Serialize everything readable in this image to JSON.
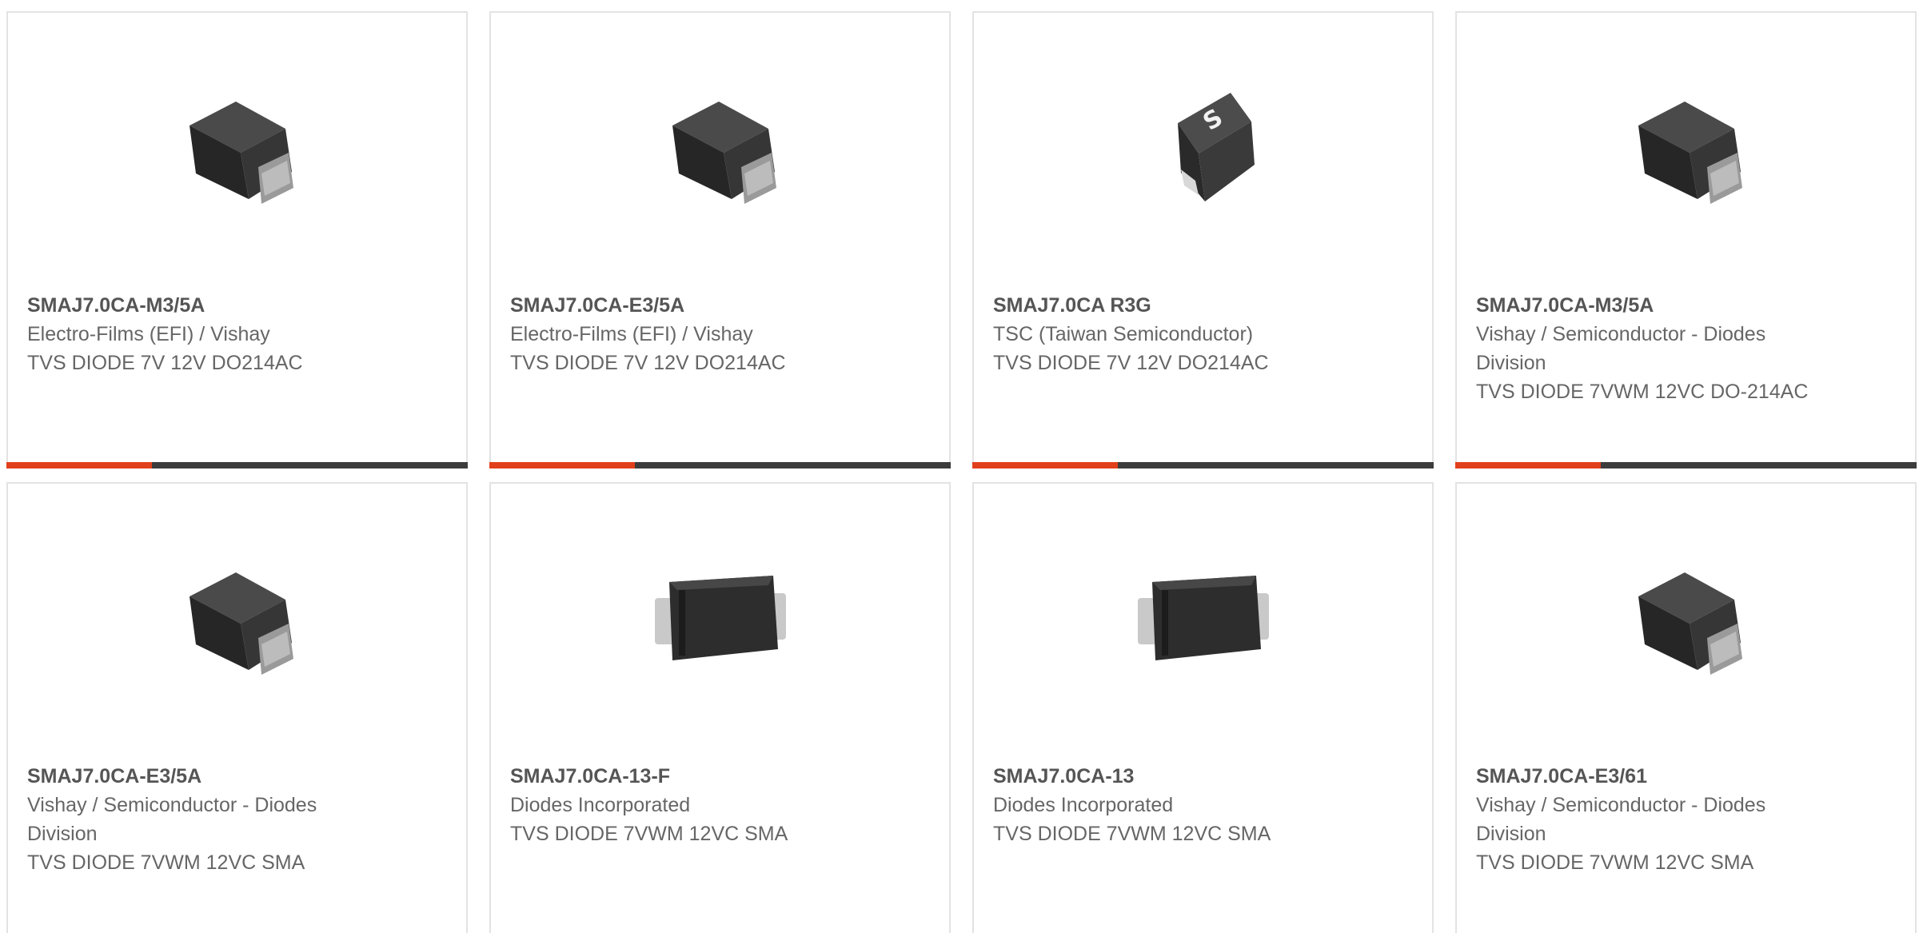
{
  "colors": {
    "accent": "#e1401c",
    "accent_bar": "#3c3c3c",
    "card_border": "#e3e3e3",
    "text": "#666666"
  },
  "products": [
    {
      "part": "SMAJ7.0CA-M3/5A",
      "manufacturer": "Electro-Films (EFI) / Vishay",
      "description": "TVS DIODE 7V 12V DO214AC",
      "image": "vishay-sma-package"
    },
    {
      "part": "SMAJ7.0CA-E3/5A",
      "manufacturer": "Electro-Films (EFI) / Vishay",
      "description": "TVS DIODE 7V 12V DO214AC",
      "image": "vishay-sma-package"
    },
    {
      "part": "SMAJ7.0CA R3G",
      "manufacturer": "TSC (Taiwan Semiconductor)",
      "description": "TVS DIODE 7V 12V DO214AC",
      "image": "tsc-sma-package"
    },
    {
      "part": "SMAJ7.0CA-M3/5A",
      "manufacturer": "Vishay / Semiconductor - Diodes Division",
      "description": "TVS DIODE 7VWM 12VC DO-214AC",
      "image": "vishay-sma-package"
    },
    {
      "part": "SMAJ7.0CA-E3/5A",
      "manufacturer": "Vishay / Semiconductor - Diodes Division",
      "description": "TVS DIODE 7VWM 12VC SMA",
      "image": "vishay-sma-package"
    },
    {
      "part": "SMAJ7.0CA-13-F",
      "manufacturer": "Diodes Incorporated",
      "description": "TVS DIODE 7VWM 12VC SMA",
      "image": "diodes-sma-package"
    },
    {
      "part": "SMAJ7.0CA-13",
      "manufacturer": "Diodes Incorporated",
      "description": "TVS DIODE 7VWM 12VC SMA",
      "image": "diodes-sma-package"
    },
    {
      "part": "SMAJ7.0CA-E3/61",
      "manufacturer": "Vishay / Semiconductor - Diodes Division",
      "description": "TVS DIODE 7VWM 12VC SMA",
      "image": "vishay-sma-package"
    }
  ]
}
